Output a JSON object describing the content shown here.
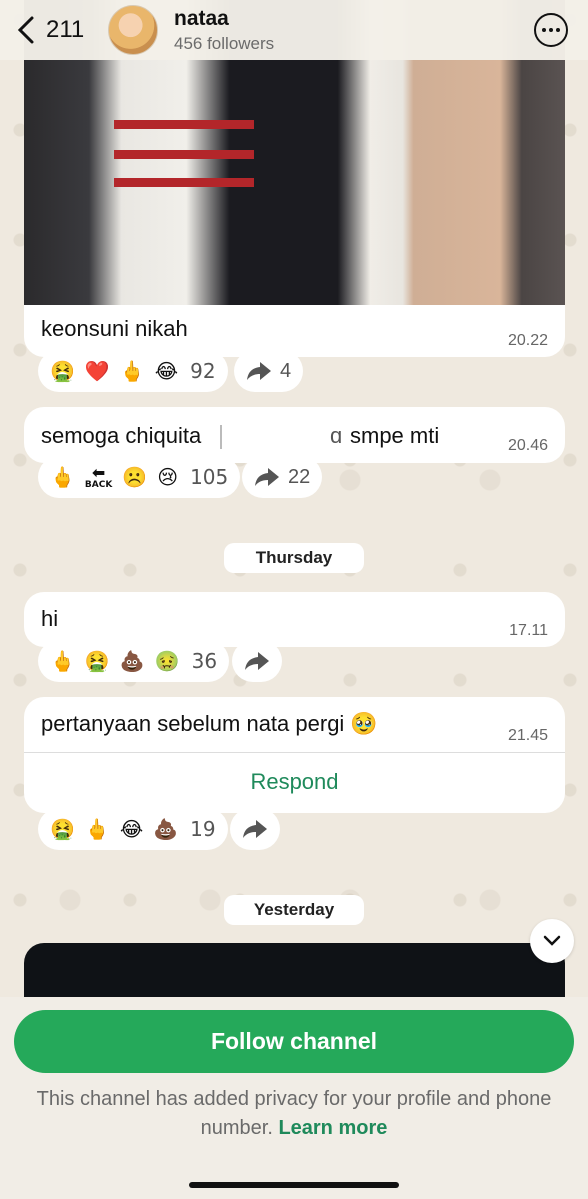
{
  "header": {
    "back_count": "211",
    "channel_name": "nataa",
    "followers": "456 followers"
  },
  "messages": [
    {
      "text": "keonsuni nikah",
      "time": "20.22",
      "reactions": [
        "🤮",
        "❤️",
        "🖕",
        "😂"
      ],
      "reaction_count": "92",
      "share_count": "4"
    },
    {
      "text_left": "semoga chiquita",
      "text_right": "smpe mti",
      "time": "20.46",
      "reactions": [
        "🖕",
        "🔙",
        "☹️",
        "😢"
      ],
      "back_label": "BACK",
      "reaction_count": "105",
      "share_count": "22"
    },
    {
      "text": "hi",
      "time": "17.11",
      "reactions": [
        "🖕",
        "🤮",
        "💩",
        "🤢"
      ],
      "reaction_count": "36"
    },
    {
      "text": "pertanyaan sebelum nata pergi 🥹",
      "time": "21.45",
      "respond_label": "Respond",
      "reactions": [
        "🤮",
        "🖕",
        "😂",
        "💩"
      ],
      "reaction_count": "19"
    }
  ],
  "date_separators": {
    "thursday": "Thursday",
    "yesterday": "Yesterday"
  },
  "footer": {
    "follow_label": "Follow channel",
    "privacy_text": "This channel has added privacy for your profile and phone number.",
    "learn_more": "Learn more"
  }
}
